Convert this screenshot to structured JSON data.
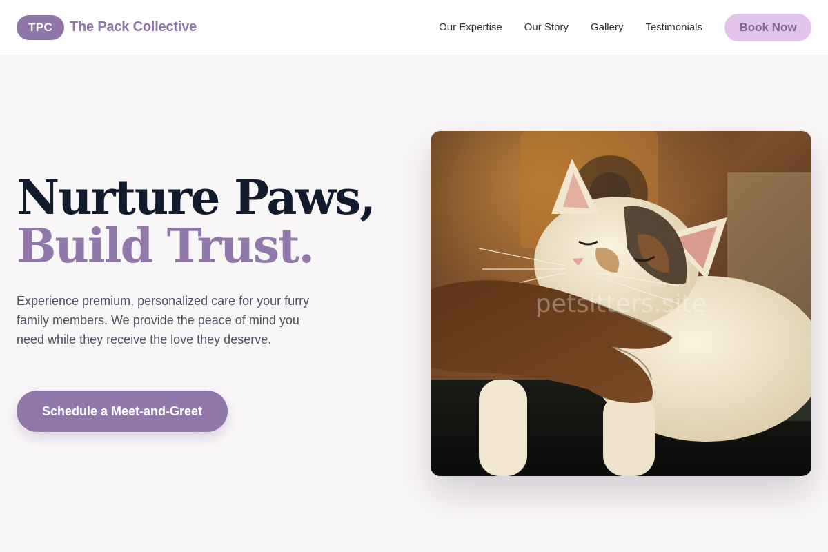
{
  "header": {
    "logo_badge": "TPC",
    "brand_name": "The Pack Collective",
    "nav": [
      {
        "label": "Our Expertise"
      },
      {
        "label": "Our Story"
      },
      {
        "label": "Gallery"
      },
      {
        "label": "Testimonials"
      }
    ],
    "book_button": "Book Now"
  },
  "hero": {
    "title_line1": "Nurture Paws,",
    "title_line2": "Build Trust.",
    "description": "Experience premium, personalized care for your furry family members. We provide the peace of mind you need while they receive the love they deserve.",
    "cta_label": "Schedule a Meet-and-Greet"
  },
  "photo": {
    "watermark": "petsitters.site",
    "subject": "calico cat being scratched under the chin by a hand"
  },
  "colors": {
    "brand": "#8f75a8",
    "accent": "#9177aa",
    "book_bg": "#e2c3e9",
    "heading_dark": "#121a2d",
    "page_bg": "#f9f6f8"
  }
}
